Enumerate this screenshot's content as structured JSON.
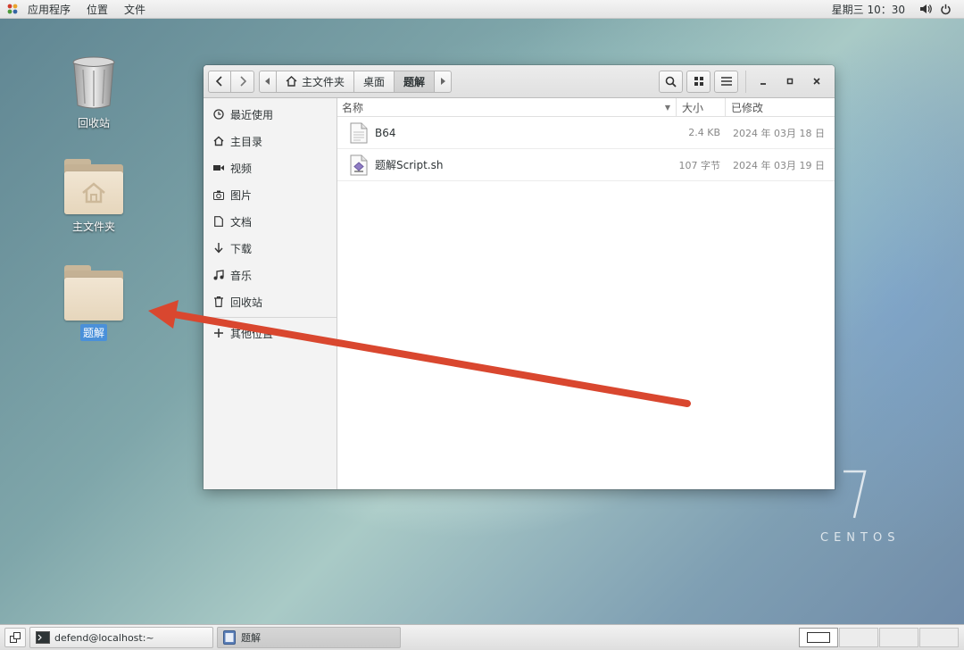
{
  "topbar": {
    "applications": "应用程序",
    "places": "位置",
    "files": "文件",
    "clock": "星期三 10：30"
  },
  "desktop": {
    "trash_label": "回收站",
    "home_label": "主文件夹",
    "folder_label": "题解"
  },
  "window": {
    "path": [
      "主文件夹",
      "桌面",
      "题解"
    ],
    "sidebar": [
      {
        "label": "最近使用",
        "icon": "clock-icon"
      },
      {
        "label": "主目录",
        "icon": "home-icon"
      },
      {
        "label": "视频",
        "icon": "video-icon"
      },
      {
        "label": "图片",
        "icon": "camera-icon"
      },
      {
        "label": "文档",
        "icon": "document-icon"
      },
      {
        "label": "下载",
        "icon": "download-icon"
      },
      {
        "label": "音乐",
        "icon": "music-icon"
      },
      {
        "label": "回收站",
        "icon": "trash-icon"
      }
    ],
    "other_locations": "其他位置",
    "columns": {
      "name": "名称",
      "size": "大小",
      "modified": "已修改"
    },
    "files": [
      {
        "name": "B64",
        "size": "2.4 KB",
        "modified": "2024 年 03月 18 日",
        "icon": "text-file-icon"
      },
      {
        "name": "题解Script.sh",
        "size": "107 字节",
        "modified": "2024 年 03月 19 日",
        "icon": "script-file-icon"
      }
    ]
  },
  "taskbar": {
    "terminal": "defend@localhost:~",
    "files": "题解"
  },
  "watermark": {
    "version": "7",
    "brand": "CENTOS"
  },
  "colors": {
    "annotation_arrow": "#d9472f",
    "selection": "#4a90d9"
  }
}
